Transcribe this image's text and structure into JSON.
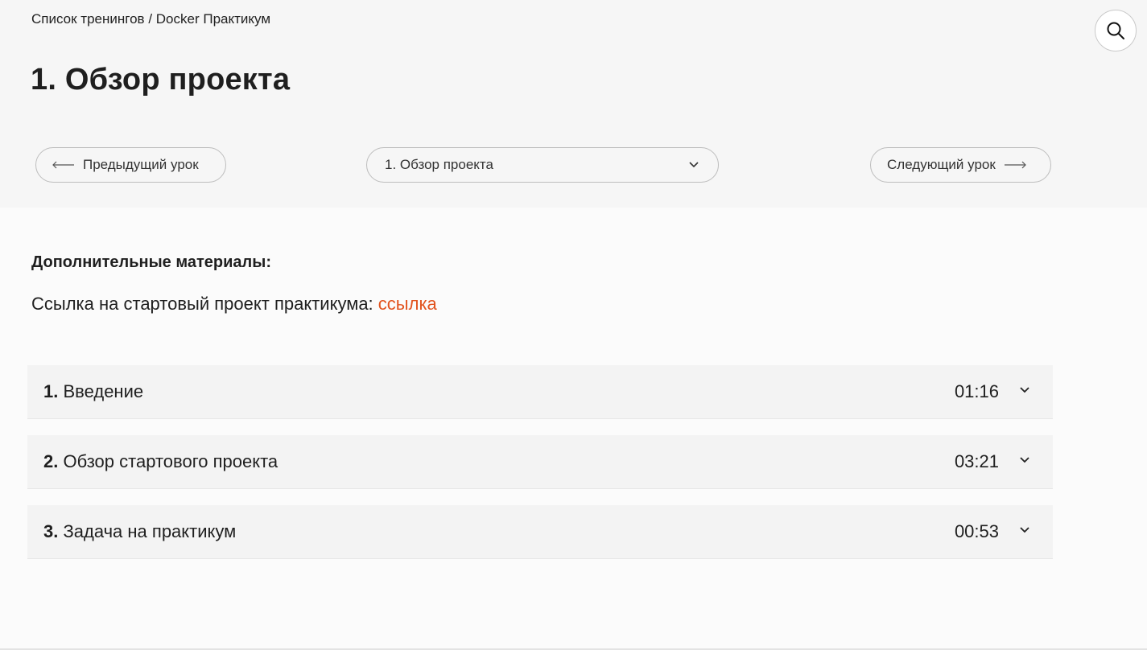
{
  "breadcrumb": {
    "root": "Список тренингов",
    "separator": "/",
    "current": "Docker Практикум"
  },
  "page_title": "1. Обзор проекта",
  "nav": {
    "prev_label": "Предыдущий урок",
    "select_value": "1. Обзор проекта",
    "next_label": "Следующий урок"
  },
  "materials": {
    "heading": "Дополнительные материалы:",
    "text": "Ссылка на стартовый проект практикума:",
    "link_label": "ссылка"
  },
  "lessons": [
    {
      "num": "1.",
      "title": "Введение",
      "duration": "01:16"
    },
    {
      "num": "2.",
      "title": "Обзор стартового проекта",
      "duration": "03:21"
    },
    {
      "num": "3.",
      "title": "Задача на практикум",
      "duration": "00:53"
    }
  ],
  "colors": {
    "accent": "#e2531e",
    "header_bg": "#f6f6f6",
    "lesson_bg": "#f3f3f3"
  },
  "icons": {
    "search": "search-icon",
    "chevron": "chevron-down-icon"
  }
}
